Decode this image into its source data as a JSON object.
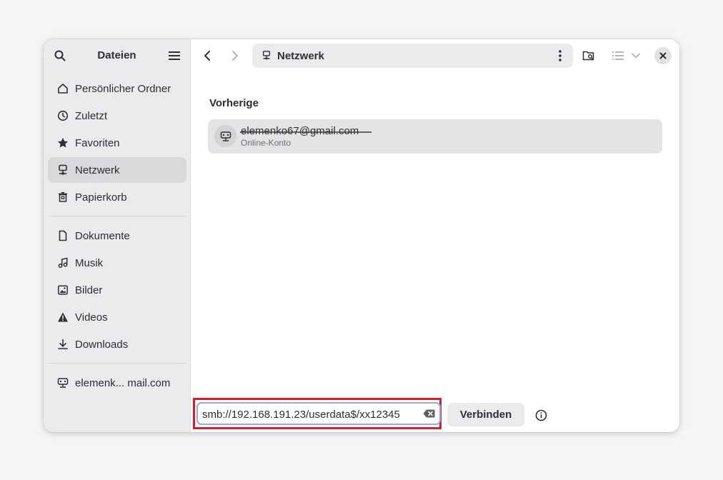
{
  "sidebar": {
    "title": "Dateien",
    "places": [
      {
        "label": "Persönlicher Ordner",
        "icon": "home-icon"
      },
      {
        "label": "Zuletzt",
        "icon": "clock-icon"
      },
      {
        "label": "Favoriten",
        "icon": "star-icon"
      },
      {
        "label": "Netzwerk",
        "icon": "network-icon",
        "active": true
      },
      {
        "label": "Papierkorb",
        "icon": "trash-icon"
      }
    ],
    "bookmarks": [
      {
        "label": "Dokumente",
        "icon": "document-icon"
      },
      {
        "label": "Musik",
        "icon": "music-icon"
      },
      {
        "label": "Bilder",
        "icon": "image-icon"
      },
      {
        "label": "Videos",
        "icon": "warning-icon"
      },
      {
        "label": "Downloads",
        "icon": "download-icon"
      }
    ],
    "accounts": [
      {
        "label": "elemenk... mail.com",
        "icon": "network-server-icon"
      }
    ]
  },
  "toolbar": {
    "location": "Netzwerk"
  },
  "main": {
    "section_title": "Vorherige",
    "servers": [
      {
        "name": "elemenko67@gmail.com",
        "subtitle": "Online-Konto"
      }
    ]
  },
  "connect": {
    "address_value": "smb://192.168.191.23/userdata$/xx12345",
    "button_label": "Verbinden"
  },
  "colors": {
    "accent_focus": "#8fb0dc",
    "highlight": "#d0202c",
    "sidebar_bg": "#ebebed"
  }
}
